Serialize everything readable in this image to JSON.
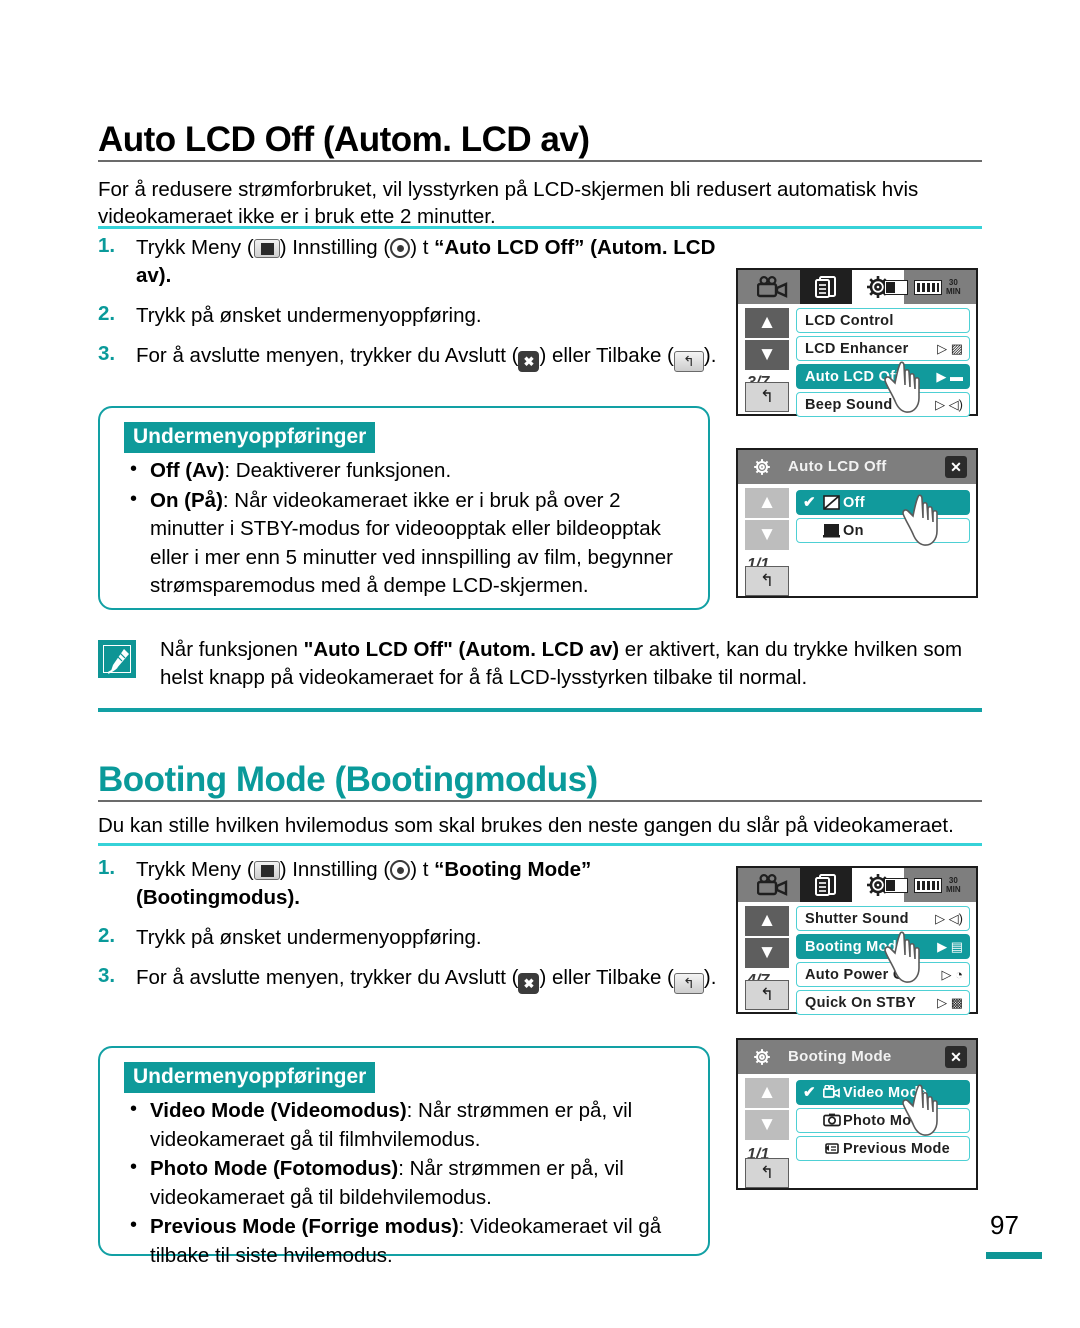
{
  "page": {
    "number": "97"
  },
  "section1": {
    "heading": "Auto LCD Off (Autom. LCD av)",
    "intro": "For å redusere strømforbruket, vil lysstyrken på LCD-skjermen bli redusert automatisk hvis videokameraet ikke er i bruk ette 2 minutter.",
    "steps": [
      {
        "num": "1.",
        "pre": "Trykk Meny (",
        "mid": ") Innstilling (",
        "post": ")  t  ",
        "bold": "“Auto LCD Off” (Autom. LCD av)",
        "tail": "."
      },
      {
        "num": "2.",
        "text": "Trykk på ønsket undermenyoppføring."
      },
      {
        "num": "3.",
        "pre": "For å avslutte menyen, trykker du Avslutt (",
        "mid": ") eller Tilbake (",
        "post": ")."
      }
    ],
    "submenu": {
      "title": "Undermenyoppføringer",
      "items": [
        {
          "bold": "Off (Av)",
          "rest": ": Deaktiverer funksjonen."
        },
        {
          "bold": "On (På)",
          "rest": ": Når videokameraet ikke er i bruk på over 2 minutter i STBY-modus for videoopptak eller bildeopptak eller i mer enn 5 minutter ved innspilling av film, begynner strømsparemodus med å dempe LCD-skjermen."
        }
      ]
    },
    "note": {
      "icon": "note-pen-icon",
      "pre": "Når funksjonen ",
      "bold1": "\"Auto LCD Off\" (Autom. LCD av)",
      "rest": " er aktivert, kan du trykke hvilken som helst knapp på videokameraet for å få LCD-lysstyrken tilbake til normal."
    },
    "screen_menu": {
      "tabs": [
        "camcorder-icon",
        "pages-icon",
        "gear-icon"
      ],
      "active_tab": 2,
      "status": {
        "card": "sd-card-icon",
        "battery": "battery-icon",
        "time": "30",
        "time_unit": "MIN"
      },
      "page_indicator": "3/7",
      "up_label": "▲",
      "down_label": "▼",
      "back_label": "↰",
      "rows": [
        {
          "label": "LCD Control",
          "selected": false,
          "right": ""
        },
        {
          "label": "LCD Enhancer",
          "selected": false,
          "right": "▷ ▨"
        },
        {
          "label": "Auto LCD Off",
          "selected": true,
          "right": "▶ ▬"
        },
        {
          "label": "Beep Sound",
          "selected": false,
          "right": "▷ ◁)"
        }
      ]
    },
    "screen_sub": {
      "title": "Auto LCD Off",
      "close_label": "✕",
      "page_indicator": "1/1",
      "up_label": "▲",
      "down_label": "▼",
      "back_label": "↰",
      "rows": [
        {
          "label": "Off",
          "selected": true,
          "check": "✔",
          "icon": "lcd-off-icon"
        },
        {
          "label": "On",
          "selected": false,
          "check": "",
          "icon": "lcd-on-icon"
        }
      ]
    }
  },
  "section2": {
    "heading": "Booting Mode (Bootingmodus)",
    "intro": "Du kan stille hvilken hvilemodus som skal brukes den neste gangen du slår på videokameraet.",
    "steps": [
      {
        "num": "1.",
        "pre": "Trykk Meny (",
        "mid": ") Innstilling (",
        "post": ")  t  ",
        "bold": "“Booting Mode” (Bootingmodus)",
        "tail": "."
      },
      {
        "num": "2.",
        "text": "Trykk på ønsket undermenyoppføring."
      },
      {
        "num": "3.",
        "pre": "For å avslutte menyen, trykker du Avslutt (",
        "mid": ") eller Tilbake (",
        "post": ")."
      }
    ],
    "submenu": {
      "title": "Undermenyoppføringer",
      "items": [
        {
          "bold": "Video Mode  (Videomodus)",
          "rest": ": Når strømmen er på, vil videokameraet gå til filmhvilemodus."
        },
        {
          "bold": "Photo Mode (Fotomodus)",
          "rest": ": Når strømmen er på, vil videokameraet gå til bildehvilemodus."
        },
        {
          "bold": "Previous Mode (Forrige modus)",
          "rest": ": Videokameraet vil gå tilbake til siste hvilemodus."
        }
      ]
    },
    "screen_menu": {
      "tabs": [
        "camcorder-icon",
        "pages-icon",
        "gear-icon"
      ],
      "active_tab": 2,
      "status": {
        "card": "sd-card-icon",
        "battery": "battery-icon",
        "time": "30",
        "time_unit": "MIN"
      },
      "page_indicator": "4/7",
      "up_label": "▲",
      "down_label": "▼",
      "back_label": "↰",
      "rows": [
        {
          "label": "Shutter Sound",
          "selected": false,
          "right": "▷ ◁)"
        },
        {
          "label": "Booting Mode",
          "selected": true,
          "right": "▶ ▤"
        },
        {
          "label": "Auto Power Off",
          "selected": false,
          "right": "▷ ◔"
        },
        {
          "label": "Quick On STBY",
          "selected": false,
          "right": "▷ ▩"
        }
      ]
    },
    "screen_sub": {
      "title": "Booting Mode",
      "close_label": "✕",
      "page_indicator": "1/1",
      "up_label": "▲",
      "down_label": "▼",
      "back_label": "↰",
      "rows": [
        {
          "label": "Video Mode",
          "selected": true,
          "check": "✔",
          "icon": "camcorder-icon"
        },
        {
          "label": "Photo Mode",
          "selected": false,
          "check": "",
          "icon": "camera-icon"
        },
        {
          "label": "Previous Mode",
          "selected": false,
          "check": "",
          "icon": "previous-icon"
        }
      ]
    }
  },
  "colors": {
    "teal": "#0e9595",
    "teal_light": "#36d2d8",
    "teal_heading": "#0a9a9a",
    "rule_gray": "#6b6b6b"
  }
}
